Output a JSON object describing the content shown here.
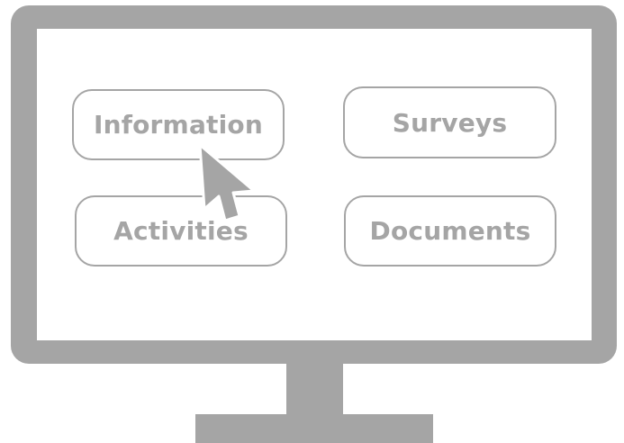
{
  "menu": {
    "items": [
      {
        "label": "Information"
      },
      {
        "label": "Surveys"
      },
      {
        "label": "Activities"
      },
      {
        "label": "Documents"
      }
    ]
  },
  "colors": {
    "frame": "#a5a5a5",
    "screen": "#ffffff",
    "text": "#a5a5a5"
  },
  "cursor": {
    "icon": "arrow-pointer-icon"
  }
}
